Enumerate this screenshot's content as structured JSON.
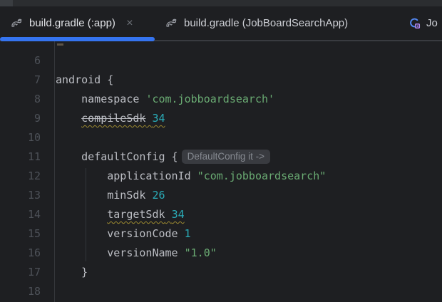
{
  "colors": {
    "accent_blue": "#3574f0",
    "string_green": "#6aab73",
    "number_cyan": "#2aacb8",
    "warning_squiggle": "#9d8a30",
    "inlay_bg": "#393b40",
    "editor_bg": "#1e1f22"
  },
  "tab_bar": {
    "tabs": [
      {
        "label": "build.gradle (:app)",
        "icon": "gradle-elephant",
        "active": true,
        "close_label": "×"
      },
      {
        "label": "build.gradle (JobBoardSearchApp)",
        "icon": "gradle-elephant",
        "active": false
      },
      {
        "label": "Jo",
        "icon": "class-icon",
        "active": false,
        "truncated": true
      }
    ]
  },
  "editor": {
    "inlay_hint_text": "DefaultConfig it ->",
    "lines": [
      {
        "number": "6",
        "segments": []
      },
      {
        "number": "7",
        "segments": [
          {
            "text": "android {"
          }
        ]
      },
      {
        "number": "8",
        "segments": [
          {
            "text": "    namespace "
          },
          {
            "text": "'com.jobboardsearch'",
            "color": "string"
          }
        ]
      },
      {
        "number": "9",
        "segments": [
          {
            "text": "    "
          },
          {
            "text": "compileSdk",
            "strike": true,
            "wave": true
          },
          {
            "text": " ",
            "wave": true
          },
          {
            "text": "34",
            "color": "number",
            "wave": true
          }
        ]
      },
      {
        "number": "10",
        "segments": []
      },
      {
        "number": "11",
        "segments": [
          {
            "text": "    defaultConfig {"
          }
        ],
        "hint": "DefaultConfig it ->"
      },
      {
        "number": "12",
        "segments": [
          {
            "text": "        applicationId "
          },
          {
            "text": "\"com.jobboardsearch\"",
            "color": "string"
          }
        ]
      },
      {
        "number": "13",
        "segments": [
          {
            "text": "        minSdk "
          },
          {
            "text": "26",
            "color": "number"
          }
        ]
      },
      {
        "number": "14",
        "segments": [
          {
            "text": "        "
          },
          {
            "text": "targetSdk",
            "wave": true
          },
          {
            "text": " ",
            "wave": true
          },
          {
            "text": "34",
            "color": "number",
            "wave": true
          }
        ]
      },
      {
        "number": "15",
        "segments": [
          {
            "text": "        versionCode "
          },
          {
            "text": "1",
            "color": "number"
          }
        ]
      },
      {
        "number": "16",
        "segments": [
          {
            "text": "        versionName "
          },
          {
            "text": "\"1.0\"",
            "color": "string"
          }
        ]
      },
      {
        "number": "17",
        "segments": [
          {
            "text": "    }"
          }
        ]
      },
      {
        "number": "18",
        "segments": []
      }
    ]
  }
}
